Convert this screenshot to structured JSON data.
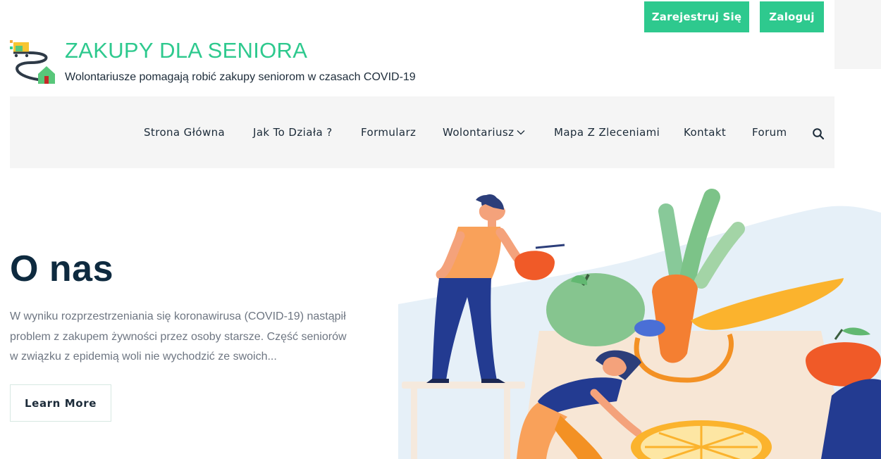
{
  "header": {
    "site_title": "ZAKUPY DLA SENIORA",
    "tagline": "Wolontariusze pomagają robić zakupy seniorom w czasach COVID-19",
    "register_label": "Zarejestruj Się",
    "login_label": "Zaloguj",
    "logo_icon": "shopping-cart-house-logo"
  },
  "nav": {
    "items": [
      {
        "label": "Strona Główna"
      },
      {
        "label": "Jak To Działa ?"
      },
      {
        "label": "Formularz"
      },
      {
        "label": "Wolontariusz",
        "has_dropdown": true
      },
      {
        "label": "Mapa Z Zleceniami"
      },
      {
        "label": "Kontakt"
      },
      {
        "label": "Forum"
      }
    ],
    "search_icon": "search-icon"
  },
  "about": {
    "title": "O nas",
    "text": "W wyniku rozprzestrzeniania się koronawirusa (COVID-19) nastąpił problem z zakupem żywności przez osoby starsze. Część seniorów w związku z epidemią woli nie wychodzić ze swoich...",
    "button_label": "Learn More"
  },
  "colors": {
    "accent": "#2ec98e",
    "dark_text": "#1c2b39",
    "nav_bg": "#f5f5f5",
    "body_text": "#6e7682"
  }
}
